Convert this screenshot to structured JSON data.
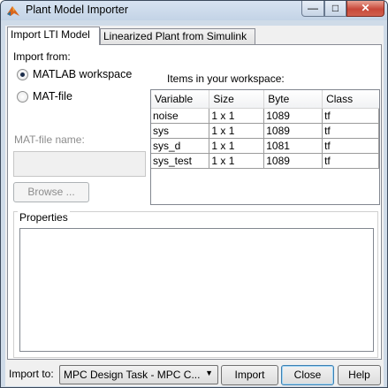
{
  "window": {
    "title": "Plant Model Importer"
  },
  "tabs": [
    {
      "label": "Import LTI Model",
      "active": true
    },
    {
      "label": "Linearized Plant from Simulink",
      "active": false
    }
  ],
  "import_from": {
    "label": "Import from:",
    "options": [
      {
        "label": "MATLAB workspace",
        "selected": true
      },
      {
        "label": "MAT-file",
        "selected": false
      }
    ]
  },
  "matfile": {
    "label": "MAT-file name:",
    "value": "",
    "browse_label": "Browse ..."
  },
  "workspace": {
    "label": "Items in your workspace:",
    "columns": [
      "Variable",
      "Size",
      "Byte",
      "Class"
    ],
    "rows": [
      [
        "noise",
        "1 x 1",
        "1089",
        "tf"
      ],
      [
        "sys",
        "1 x 1",
        "1089",
        "tf"
      ],
      [
        "sys_d",
        "1 x 1",
        "1081",
        "tf"
      ],
      [
        "sys_test",
        "1 x 1",
        "1089",
        "tf"
      ]
    ]
  },
  "properties": {
    "label": "Properties"
  },
  "footer": {
    "import_to_label": "Import to:",
    "import_to_value": "MPC Design Task - MPC C...",
    "import_button": "Import",
    "close_button": "Close",
    "help_button": "Help"
  },
  "titlebar_controls": {
    "min_symbol": "—",
    "max_symbol": "□",
    "close_symbol": "✕"
  },
  "colors": {
    "accent": "#3c7fb1",
    "title_bg": "#c3d3e6",
    "close_red": "#c7483a"
  }
}
